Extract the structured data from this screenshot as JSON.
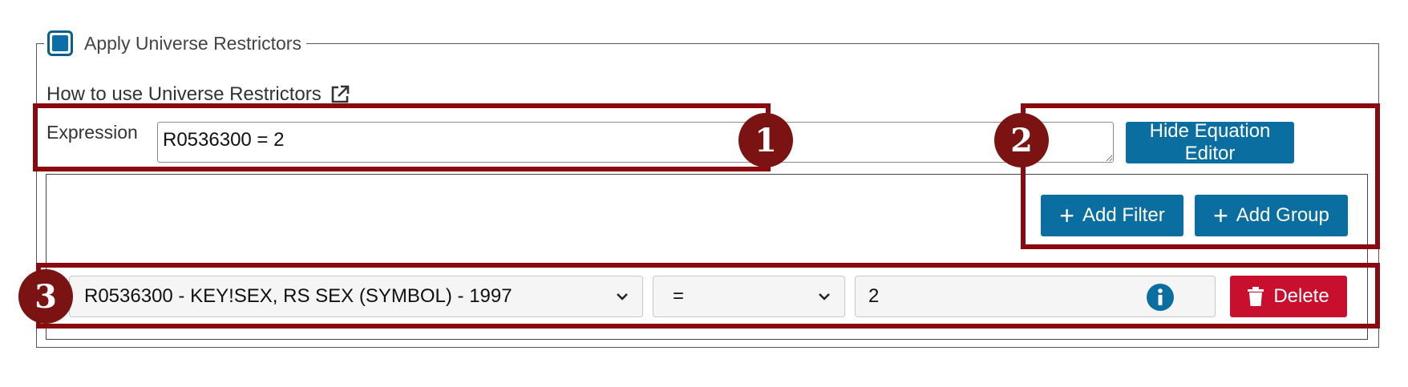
{
  "restrictors": {
    "checked": true,
    "label": "Apply Universe Restrictors",
    "howto_link": "How to use Universe Restrictors"
  },
  "expression": {
    "label": "Expression",
    "value": "R0536300 = 2"
  },
  "buttons": {
    "hide_editor": "Hide Equation Editor",
    "add_filter": "Add Filter",
    "add_group": "Add Group",
    "delete": "Delete"
  },
  "filter_row": {
    "variable": "R0536300 - KEY!SEX, RS SEX (SYMBOL) - 1997",
    "operator": "=",
    "value": "2"
  },
  "annotations": [
    "1",
    "2",
    "3"
  ],
  "colors": {
    "primary_blue": "#0b6ea1",
    "delete_red": "#c8102e",
    "annotation_red": "#8b0a0f",
    "badge_red": "#7c1313"
  },
  "icons": {
    "external_link": "external-link-icon",
    "plus": "plus-icon",
    "chevron": "chevron-down-icon",
    "info": "info-icon",
    "trash": "trash-icon"
  }
}
